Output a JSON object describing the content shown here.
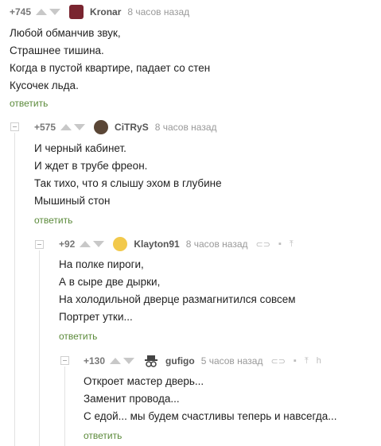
{
  "comments": [
    {
      "rating": "+745",
      "author": "Kronar",
      "time": "8 часов назад",
      "lines": [
        "Любой обманчив звук,",
        "Страшнее тишина.",
        "Когда в пустой квартире, падает со стен",
        "Кусочек льда."
      ],
      "reply": "ответить",
      "avatar_color": "#7a2530"
    },
    {
      "rating": "+575",
      "author": "CiTRyS",
      "time": "8 часов назад",
      "lines": [
        "И черный кабинет.",
        "И ждет в трубе фреон.",
        "Так тихо, что я слышу эхом в глубине",
        "Мышиный стон"
      ],
      "reply": "ответить",
      "avatar_color": "#5a4636"
    },
    {
      "rating": "+92",
      "author": "Klayton91",
      "time": "8 часов назад",
      "lines": [
        "На полке пироги,",
        "А в сыре две дырки,",
        "На холодильной дверце размагнитился совсем",
        "Портрет утки..."
      ],
      "reply": "ответить",
      "avatar_color": "#f2c94c"
    },
    {
      "rating": "+130",
      "author": "gufigo",
      "time": "5 часов назад",
      "lines": [
        "Откроет мастер дверь...",
        "Заменит провода...",
        "С едой... мы будем счастливы теперь и навсегда..."
      ],
      "reply": "ответить",
      "avatar_color": "#444444"
    }
  ],
  "tools": {
    "link_icon": "⊂⊃",
    "save_icon": "▪",
    "up_icon": "⤒",
    "more_icon": "h"
  }
}
